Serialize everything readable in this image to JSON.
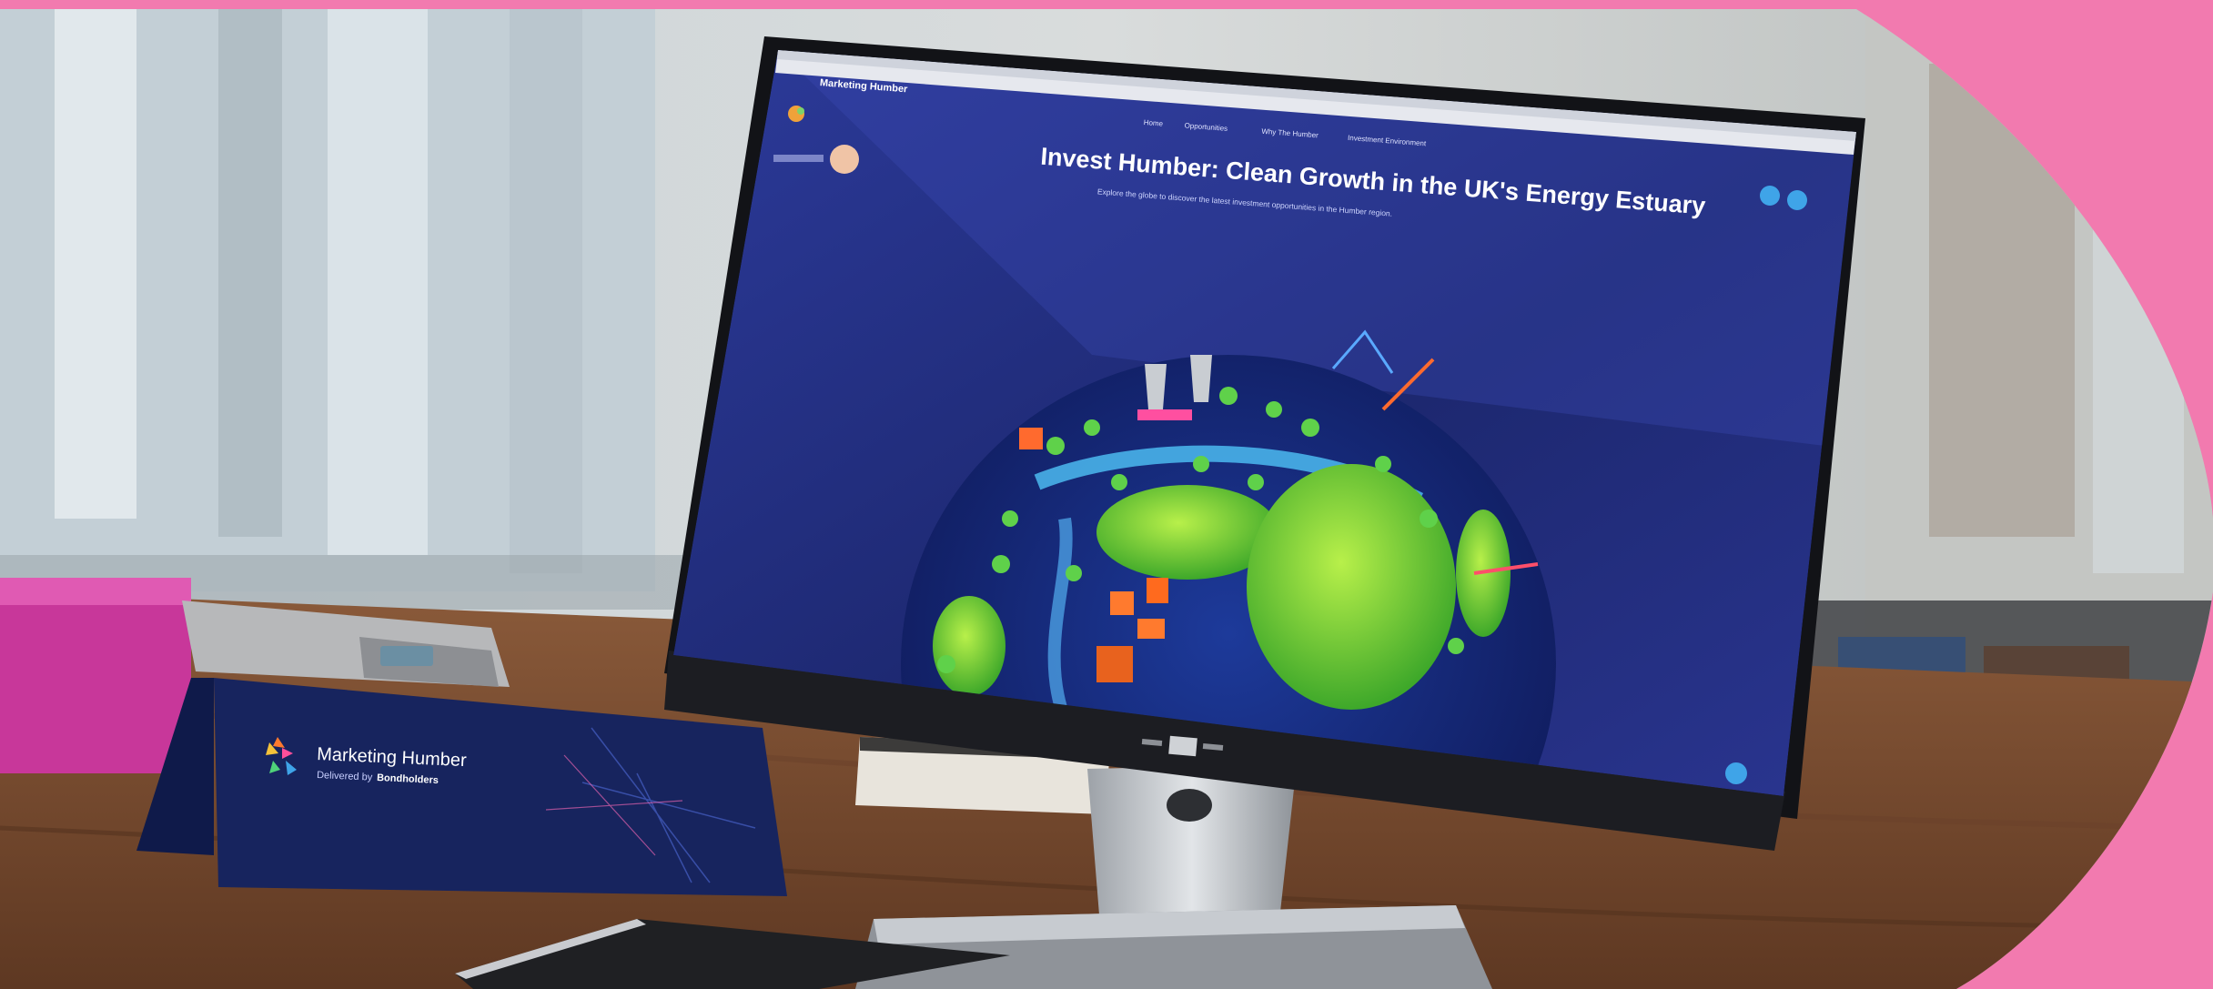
{
  "colors": {
    "frame": "#f27aaf",
    "screen_bg": "#1f2a78",
    "card_bg": "#16235c",
    "desk": "#7a4a2e",
    "monitor": "#1a1c22"
  },
  "screen": {
    "brand": "Marketing Humber",
    "nav": [
      "Home",
      "Opportunities",
      "Why The Humber",
      "Investment Environment"
    ],
    "title": "Invest Humber: Clean Growth in the UK's Energy Estuary",
    "subtitle": "Explore the globe to discover the latest investment opportunities in the Humber region."
  },
  "card": {
    "brand": "Marketing Humber",
    "tagline_prefix": "Delivered by",
    "tagline_org": "Bondholders"
  }
}
